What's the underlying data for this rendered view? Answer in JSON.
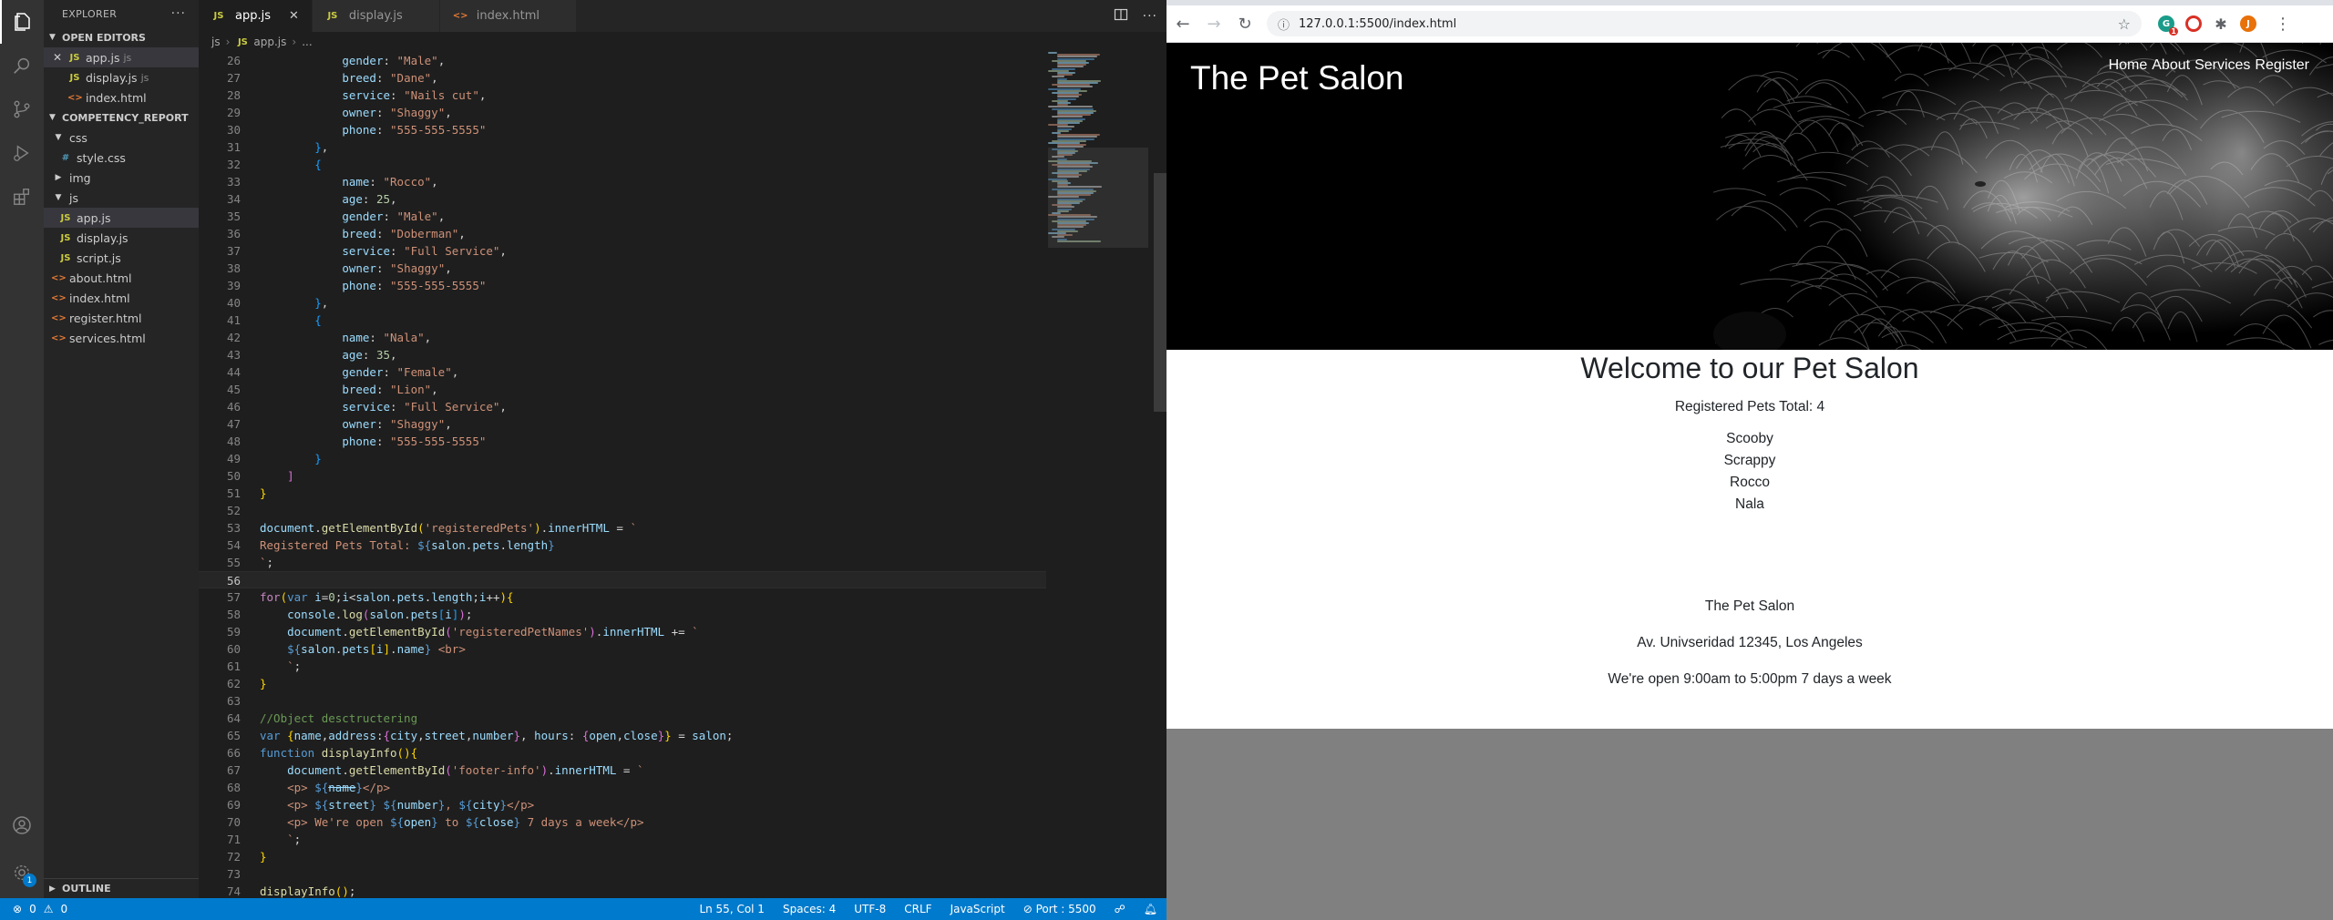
{
  "vscode": {
    "explorer_title": "EXPLORER",
    "open_editors_label": "OPEN EDITORS",
    "open_editors": [
      {
        "name": "app.js",
        "suffix": "js",
        "type": "js"
      },
      {
        "name": "display.js",
        "suffix": "js",
        "type": "js"
      },
      {
        "name": "index.html",
        "suffix": "",
        "type": "html"
      }
    ],
    "project_label": "COMPETENCY_REPORT",
    "tree": [
      {
        "name": "css",
        "type": "folder",
        "open": true,
        "depth": 1
      },
      {
        "name": "style.css",
        "type": "css",
        "depth": 2
      },
      {
        "name": "img",
        "type": "folder",
        "open": false,
        "depth": 1
      },
      {
        "name": "js",
        "type": "folder",
        "open": true,
        "depth": 1
      },
      {
        "name": "app.js",
        "type": "js",
        "depth": 2
      },
      {
        "name": "display.js",
        "type": "js",
        "depth": 2
      },
      {
        "name": "script.js",
        "type": "js",
        "depth": 2
      },
      {
        "name": "about.html",
        "type": "html",
        "depth": 1
      },
      {
        "name": "index.html",
        "type": "html",
        "depth": 1
      },
      {
        "name": "register.html",
        "type": "html",
        "depth": 1
      },
      {
        "name": "services.html",
        "type": "html",
        "depth": 1
      }
    ],
    "outline_label": "OUTLINE",
    "tabs": [
      {
        "name": "app.js",
        "type": "js",
        "active": true
      },
      {
        "name": "display.js",
        "type": "js",
        "active": false
      },
      {
        "name": "index.html",
        "type": "html",
        "active": false
      }
    ],
    "breadcrumb": [
      "js",
      "app.js",
      "..."
    ],
    "code_lines": [
      {
        "n": 26,
        "h": "            <span class='p'>gender</span>: <span class='s'>\"Male\"</span>,"
      },
      {
        "n": 27,
        "h": "            <span class='p'>breed</span>: <span class='s'>\"Dane\"</span>,"
      },
      {
        "n": 28,
        "h": "            <span class='p'>service</span>: <span class='s'>\"Nails cut\"</span>,"
      },
      {
        "n": 29,
        "h": "            <span class='p'>owner</span>: <span class='s'>\"Shaggy\"</span>,"
      },
      {
        "n": 30,
        "h": "            <span class='p'>phone</span>: <span class='s'>\"555-555-5555\"</span>"
      },
      {
        "n": 31,
        "h": "        <span class='br3'>}</span>,"
      },
      {
        "n": 32,
        "h": "        <span class='br3'>{</span>"
      },
      {
        "n": 33,
        "h": "            <span class='p'>name</span>: <span class='s'>\"Rocco\"</span>,"
      },
      {
        "n": 34,
        "h": "            <span class='p'>age</span>: <span class='n'>25</span>,"
      },
      {
        "n": 35,
        "h": "            <span class='p'>gender</span>: <span class='s'>\"Male\"</span>,"
      },
      {
        "n": 36,
        "h": "            <span class='p'>breed</span>: <span class='s'>\"Doberman\"</span>,"
      },
      {
        "n": 37,
        "h": "            <span class='p'>service</span>: <span class='s'>\"Full Service\"</span>,"
      },
      {
        "n": 38,
        "h": "            <span class='p'>owner</span>: <span class='s'>\"Shaggy\"</span>,"
      },
      {
        "n": 39,
        "h": "            <span class='p'>phone</span>: <span class='s'>\"555-555-5555\"</span>"
      },
      {
        "n": 40,
        "h": "        <span class='br3'>}</span>,"
      },
      {
        "n": 41,
        "h": "        <span class='br3'>{</span>"
      },
      {
        "n": 42,
        "h": "            <span class='p'>name</span>: <span class='s'>\"Nala\"</span>,"
      },
      {
        "n": 43,
        "h": "            <span class='p'>age</span>: <span class='n'>35</span>,"
      },
      {
        "n": 44,
        "h": "            <span class='p'>gender</span>: <span class='s'>\"Female\"</span>,"
      },
      {
        "n": 45,
        "h": "            <span class='p'>breed</span>: <span class='s'>\"Lion\"</span>,"
      },
      {
        "n": 46,
        "h": "            <span class='p'>service</span>: <span class='s'>\"Full Service\"</span>,"
      },
      {
        "n": 47,
        "h": "            <span class='p'>owner</span>: <span class='s'>\"Shaggy\"</span>,"
      },
      {
        "n": 48,
        "h": "            <span class='p'>phone</span>: <span class='s'>\"555-555-5555\"</span>"
      },
      {
        "n": 49,
        "h": "        <span class='br3'>}</span>"
      },
      {
        "n": 50,
        "h": "    <span class='br2'>]</span>"
      },
      {
        "n": 51,
        "h": "<span class='br1'>}</span>"
      },
      {
        "n": 52,
        "h": ""
      },
      {
        "n": 53,
        "h": "<span class='p'>document</span>.<span class='f'>getElementById</span><span class='br1'>(</span><span class='s'>'registeredPets'</span><span class='br1'>)</span>.<span class='p'>innerHTML</span> = <span class='s'>`</span>"
      },
      {
        "n": 54,
        "h": "<span class='s'>Registered Pets Total: </span><span class='k'>${</span><span class='p'>salon</span>.<span class='p'>pets</span>.<span class='p'>length</span><span class='k'>}</span>"
      },
      {
        "n": 55,
        "h": "<span class='s'>`</span>;",
        "cur": false
      },
      {
        "n": 56,
        "h": "",
        "cur": true
      },
      {
        "n": 57,
        "h": "<span class='kc'>for</span><span class='br1'>(</span><span class='k'>var</span> <span class='p'>i</span>=<span class='n'>0</span>;<span class='p'>i</span>&lt;<span class='p'>salon</span>.<span class='p'>pets</span>.<span class='p'>length</span>;<span class='p'>i</span>++<span class='br1'>)</span><span class='br1'>{</span>"
      },
      {
        "n": 58,
        "h": "    <span class='p'>console</span>.<span class='f'>log</span><span class='br2'>(</span><span class='p'>salon</span>.<span class='p'>pets</span><span class='br3'>[</span><span class='p'>i</span><span class='br3'>]</span><span class='br2'>)</span>;"
      },
      {
        "n": 59,
        "h": "    <span class='p'>document</span>.<span class='f'>getElementById</span><span class='br2'>(</span><span class='s'>'registeredPetNames'</span><span class='br2'>)</span>.<span class='p'>innerHTML</span> += <span class='s'>`</span>"
      },
      {
        "n": 60,
        "h": "    <span class='k'>${</span><span class='p'>salon</span>.<span class='p'>pets</span><span class='br1'>[</span><span class='p'>i</span><span class='br1'>]</span>.<span class='p'>name</span><span class='k'>}</span><span class='s'> &lt;br&gt;</span>"
      },
      {
        "n": 61,
        "h": "    <span class='s'>`</span>;"
      },
      {
        "n": 62,
        "h": "<span class='br1'>}</span>"
      },
      {
        "n": 63,
        "h": ""
      },
      {
        "n": 64,
        "h": "<span class='c'>//Object desctructering</span>"
      },
      {
        "n": 65,
        "h": "<span class='k'>var</span> <span class='br1'>{</span><span class='p'>name</span>,<span class='p'>address</span>:<span class='br2'>{</span><span class='p'>city</span>,<span class='p'>street</span>,<span class='p'>number</span><span class='br2'>}</span>, <span class='p'>hours</span>: <span class='br2'>{</span><span class='p'>open</span>,<span class='p'>close</span><span class='br2'>}</span><span class='br1'>}</span> = <span class='p'>salon</span>;"
      },
      {
        "n": 66,
        "h": "<span class='k'>function</span> <span class='f'>displayInfo</span><span class='br1'>()</span><span class='br1'>{</span>"
      },
      {
        "n": 67,
        "h": "    <span class='p'>document</span>.<span class='f'>getElementById</span><span class='br2'>(</span><span class='s'>'footer-info'</span><span class='br2'>)</span>.<span class='p'>innerHTML</span> = <span class='s'>`</span>"
      },
      {
        "n": 68,
        "h": "    <span class='s'>&lt;p&gt; </span><span class='k'>${</span><span class='p'><s>name</s></span><span class='k'>}</span><span class='s'>&lt;/p&gt;</span>"
      },
      {
        "n": 69,
        "h": "    <span class='s'>&lt;p&gt; </span><span class='k'>${</span><span class='p'>street</span><span class='k'>}</span><span class='s'> </span><span class='k'>${</span><span class='p'>number</span><span class='k'>}</span><span class='s'>, </span><span class='k'>${</span><span class='p'>city</span><span class='k'>}</span><span class='s'>&lt;/p&gt;</span>"
      },
      {
        "n": 70,
        "h": "    <span class='s'>&lt;p&gt; We're open </span><span class='k'>${</span><span class='p'>open</span><span class='k'>}</span><span class='s'> to </span><span class='k'>${</span><span class='p'>close</span><span class='k'>}</span><span class='s'> 7 days a week&lt;/p&gt;</span>"
      },
      {
        "n": 71,
        "h": "    <span class='s'>`</span>;"
      },
      {
        "n": 72,
        "h": "<span class='br1'>}</span>"
      },
      {
        "n": 73,
        "h": ""
      },
      {
        "n": 74,
        "h": "<span class='f'>displayInfo</span><span class='br1'>()</span>;"
      }
    ],
    "status": {
      "errors": "0",
      "warnings": "0",
      "position": "Ln 55, Col 1",
      "spaces": "Spaces: 4",
      "encoding": "UTF-8",
      "eol": "CRLF",
      "language": "JavaScript",
      "port": "Port : 5500"
    },
    "accounts_badge": "1"
  },
  "browser": {
    "url": "127.0.0.1:5500/index.html",
    "ext_badge": "1",
    "profile_initial": "J",
    "site": {
      "title": "The Pet Salon",
      "nav": [
        "Home",
        "About",
        "Services",
        "Register"
      ],
      "welcome": "Welcome to our Pet Salon",
      "registered_total": "Registered Pets Total: 4",
      "pet_names": [
        "Scooby",
        "Scrappy",
        "Rocco",
        "Nala"
      ],
      "footer": [
        "The Pet Salon",
        "Av. Univseridad 12345, Los Angeles",
        "We're open 9:00am to 5:00pm 7 days a week"
      ]
    }
  }
}
